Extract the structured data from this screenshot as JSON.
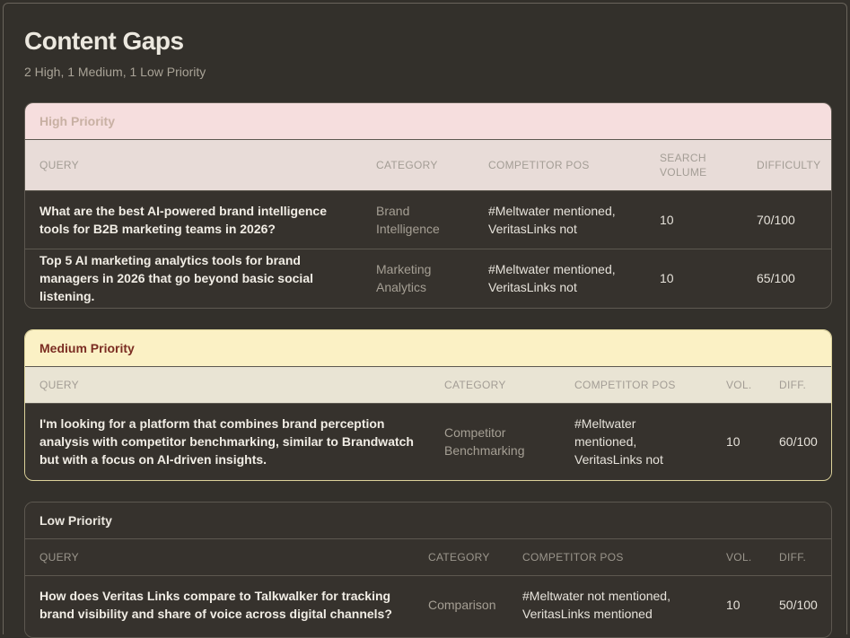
{
  "page": {
    "title": "Content Gaps",
    "subtitle": "2 High, 1 Medium, 1 Low Priority"
  },
  "high": {
    "label": "High Priority",
    "headers": {
      "query": "QUERY",
      "category": "CATEGORY",
      "competitor": "COMPETITOR POS",
      "volume": "SEARCH VOLUME",
      "difficulty": "DIFFICULTY"
    },
    "rows": [
      {
        "query": "What are the best AI-powered brand intelligence tools for B2B marketing teams in 2026?",
        "category": "Brand Intelligence",
        "competitor": "#Meltwater mentioned, VeritasLinks not",
        "volume": "10",
        "difficulty": "70/100"
      },
      {
        "query": "Top 5 AI marketing analytics tools for brand managers in 2026 that go beyond basic social listening.",
        "category": "Marketing Analytics",
        "competitor": "#Meltwater mentioned, VeritasLinks not",
        "volume": "10",
        "difficulty": "65/100"
      }
    ]
  },
  "medium": {
    "label": "Medium Priority",
    "headers": {
      "query": "QUERY",
      "category": "CATEGORY",
      "competitor": "COMPETITOR POS",
      "volume": "VOL.",
      "difficulty": "DIFF."
    },
    "rows": [
      {
        "query": "I'm looking for a platform that combines brand perception analysis with competitor benchmarking, similar to Brandwatch but with a focus on AI-driven insights.",
        "category": "Competitor Benchmarking",
        "competitor": "#Meltwater mentioned, VeritasLinks not",
        "volume": "10",
        "difficulty": "60/100"
      }
    ]
  },
  "low": {
    "label": "Low Priority",
    "headers": {
      "query": "QUERY",
      "category": "CATEGORY",
      "competitor": "COMPETITOR POS",
      "volume": "VOL.",
      "difficulty": "DIFF."
    },
    "rows": [
      {
        "query": "How does Veritas Links compare to Talkwalker for tracking brand visibility and share of voice across digital channels?",
        "category": "Comparison",
        "competitor": "#Meltwater not mentioned, VeritasLinks mentioned",
        "volume": "10",
        "difficulty": "50/100"
      }
    ]
  },
  "colors": {
    "background": "#33302b",
    "high_header": "#f6dede",
    "medium_header": "#fbf1c5",
    "medium_label": "#7b2d22"
  }
}
